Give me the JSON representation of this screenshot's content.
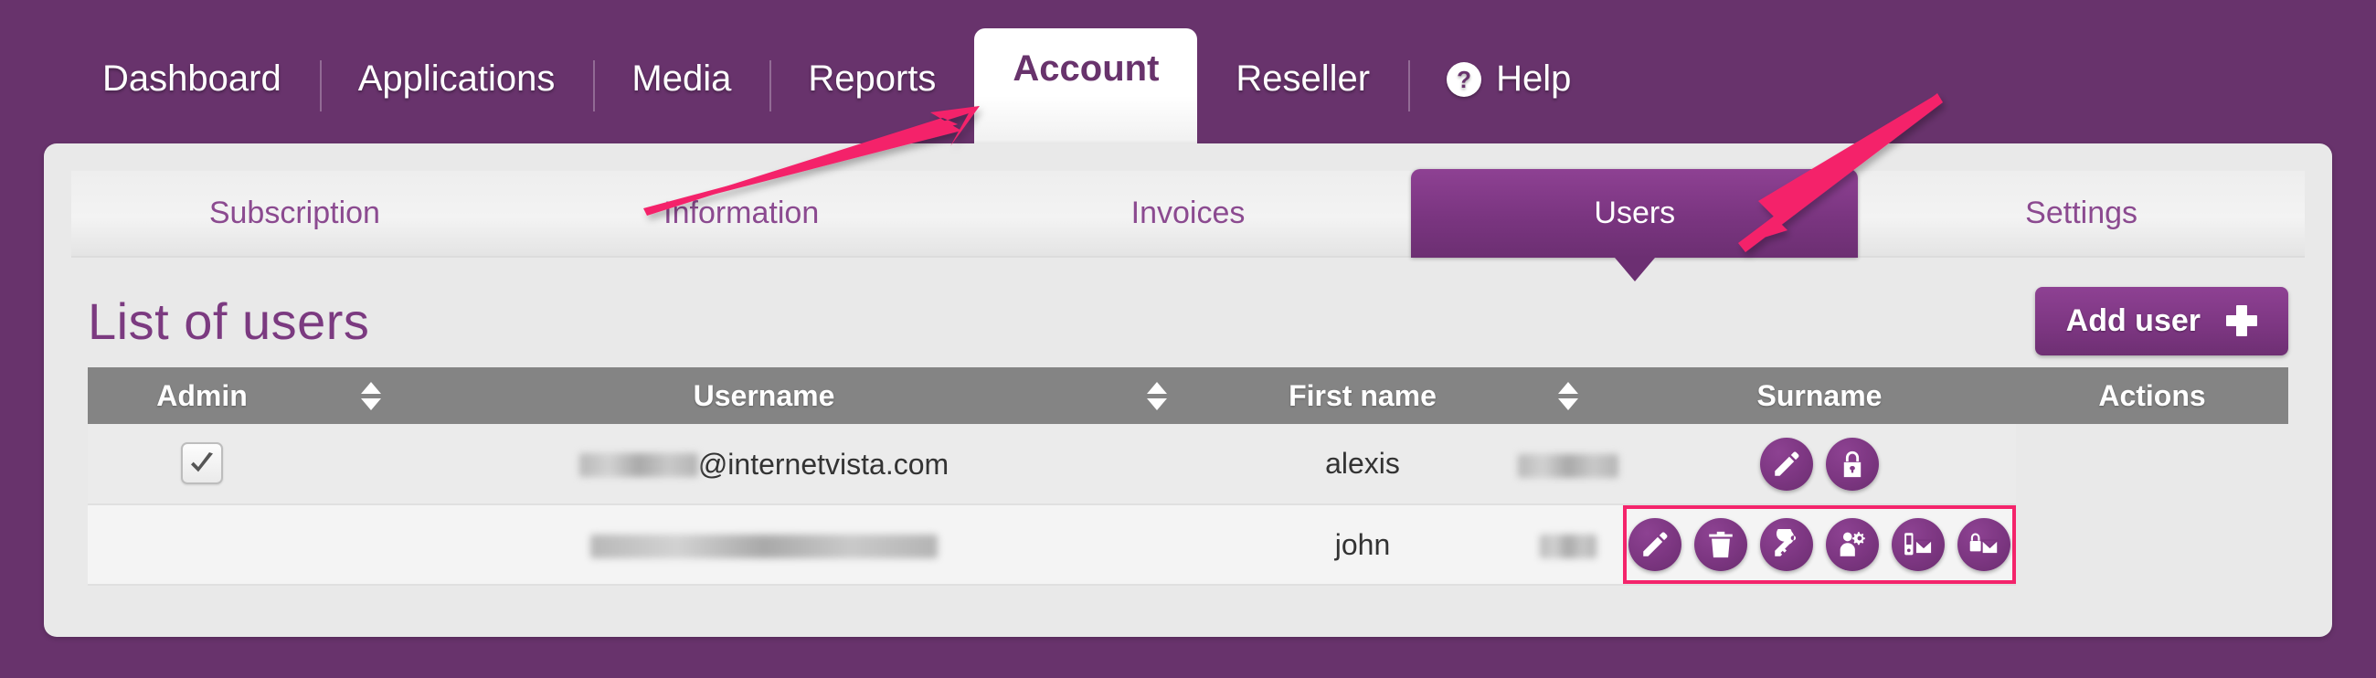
{
  "theme": {
    "brand_purple": "#68336C",
    "accent_purple": "#7C3681",
    "panel_gray": "#E9E9E9",
    "table_header_gray": "#848484",
    "annotation_pink": "#F4246B"
  },
  "topnav": {
    "items": [
      {
        "label": "Dashboard",
        "active": false
      },
      {
        "label": "Applications",
        "active": false
      },
      {
        "label": "Media",
        "active": false
      },
      {
        "label": "Reports",
        "active": false
      },
      {
        "label": "Account",
        "active": true
      },
      {
        "label": "Reseller",
        "active": false
      },
      {
        "label": "Help",
        "active": false,
        "icon": "question-mark-circle-icon",
        "icon_glyph": "?"
      }
    ]
  },
  "subtabs": {
    "items": [
      {
        "label": "Subscription",
        "active": false
      },
      {
        "label": "Information",
        "active": false
      },
      {
        "label": "Invoices",
        "active": false
      },
      {
        "label": "Users",
        "active": true
      },
      {
        "label": "Settings",
        "active": false
      }
    ]
  },
  "content": {
    "page_title": "List of users",
    "add_user_label": "Add user",
    "add_user_icon": "plus-icon"
  },
  "table": {
    "columns": [
      {
        "key": "admin",
        "label": "Admin",
        "sortable": true
      },
      {
        "key": "username",
        "label": "Username",
        "sortable": true
      },
      {
        "key": "first_name",
        "label": "First name",
        "sortable": true
      },
      {
        "key": "surname",
        "label": "Surname",
        "sortable": false
      },
      {
        "key": "actions",
        "label": "Actions",
        "sortable": false
      }
    ],
    "rows": [
      {
        "admin_checked": true,
        "username_redacted_prefix": true,
        "username_visible": "@internetvista.com",
        "first_name": "alexis",
        "surname_redacted": true,
        "surname": "",
        "actions": [
          {
            "name": "edit-user-button",
            "icon": "pencil-icon"
          },
          {
            "name": "lock-user-button",
            "icon": "lock-icon"
          }
        ],
        "actions_highlighted": false
      },
      {
        "admin_checked": false,
        "username_redacted_prefix": true,
        "username_visible": "",
        "first_name": "john",
        "surname_redacted": true,
        "surname": "",
        "actions": [
          {
            "name": "edit-user-button",
            "icon": "pencil-icon"
          },
          {
            "name": "delete-user-button",
            "icon": "trash-icon"
          },
          {
            "name": "reset-password-button",
            "icon": "key-icon"
          },
          {
            "name": "user-settings-button",
            "icon": "user-gear-icon"
          },
          {
            "name": "send-sms-button",
            "icon": "phone-envelope-icon"
          },
          {
            "name": "send-credentials-button",
            "icon": "lock-envelope-icon"
          }
        ],
        "actions_highlighted": true
      }
    ]
  },
  "annotations": [
    {
      "name": "arrow-to-users-tab",
      "color": "#F4246B"
    },
    {
      "name": "arrow-to-add-user-button",
      "color": "#F4246B"
    }
  ]
}
